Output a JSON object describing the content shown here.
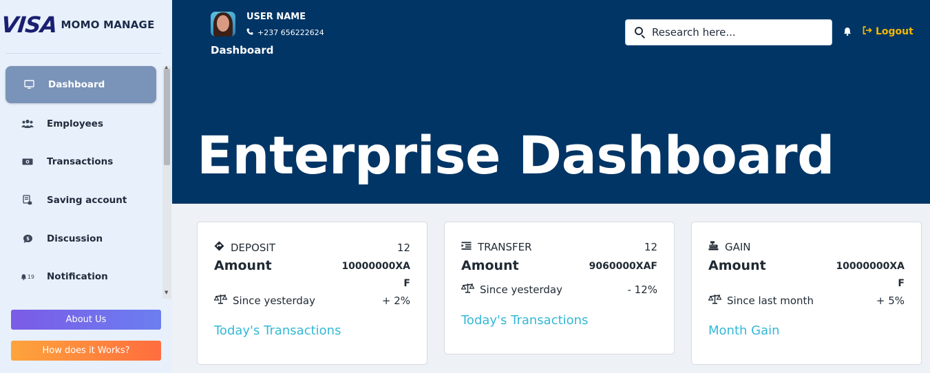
{
  "brand": {
    "logo_text": "VISA",
    "app_name": "MOMO MANAGE"
  },
  "sidebar": {
    "items": [
      {
        "label": "Dashboard",
        "icon": "monitor-icon",
        "active": true
      },
      {
        "label": "Employees",
        "icon": "users-icon"
      },
      {
        "label": "Transactions",
        "icon": "money-bill-icon"
      },
      {
        "label": "Saving account",
        "icon": "coins-icon"
      },
      {
        "label": "Discussion",
        "icon": "comment-dollar-icon"
      },
      {
        "label": "Notification",
        "icon": "bell-icon",
        "badge": "19"
      }
    ],
    "about_label": "About Us",
    "how_label": "How does it Works?"
  },
  "header": {
    "user_name": "USER NAME",
    "user_phone": "+237 656222624",
    "page_title": "Dashboard",
    "search_placeholder": "Research here...",
    "logout_label": "Logout",
    "hero_title": "Enterprise Dashboard"
  },
  "cards": [
    {
      "title": "DEPOSIT",
      "icon": "diamond-arrow-icon",
      "count": "12",
      "amount_label": "Amount",
      "amount_value": "10000000XAF",
      "trend_label": "Since yesterday",
      "trend_value": "+ 2%",
      "link": "Today's Transactions"
    },
    {
      "title": "TRANSFER",
      "icon": "indent-icon",
      "count": "12",
      "amount_label": "Amount",
      "amount_value": "9060000XAF",
      "trend_label": "Since yesterday",
      "trend_value": "- 12%",
      "link": "Today's Transactions"
    },
    {
      "title": "GAIN",
      "icon": "cash-register-icon",
      "amount_label": "Amount",
      "amount_value": "10000000XAF",
      "trend_label": "Since last month",
      "trend_value": "+ 5%",
      "link": "Month Gain"
    }
  ],
  "colors": {
    "hero_bg": "#003565",
    "sidebar_bg": "#e8f0fb",
    "active_item": "#7a93b8",
    "logout": "#f5b800",
    "link": "#33b8d6"
  }
}
